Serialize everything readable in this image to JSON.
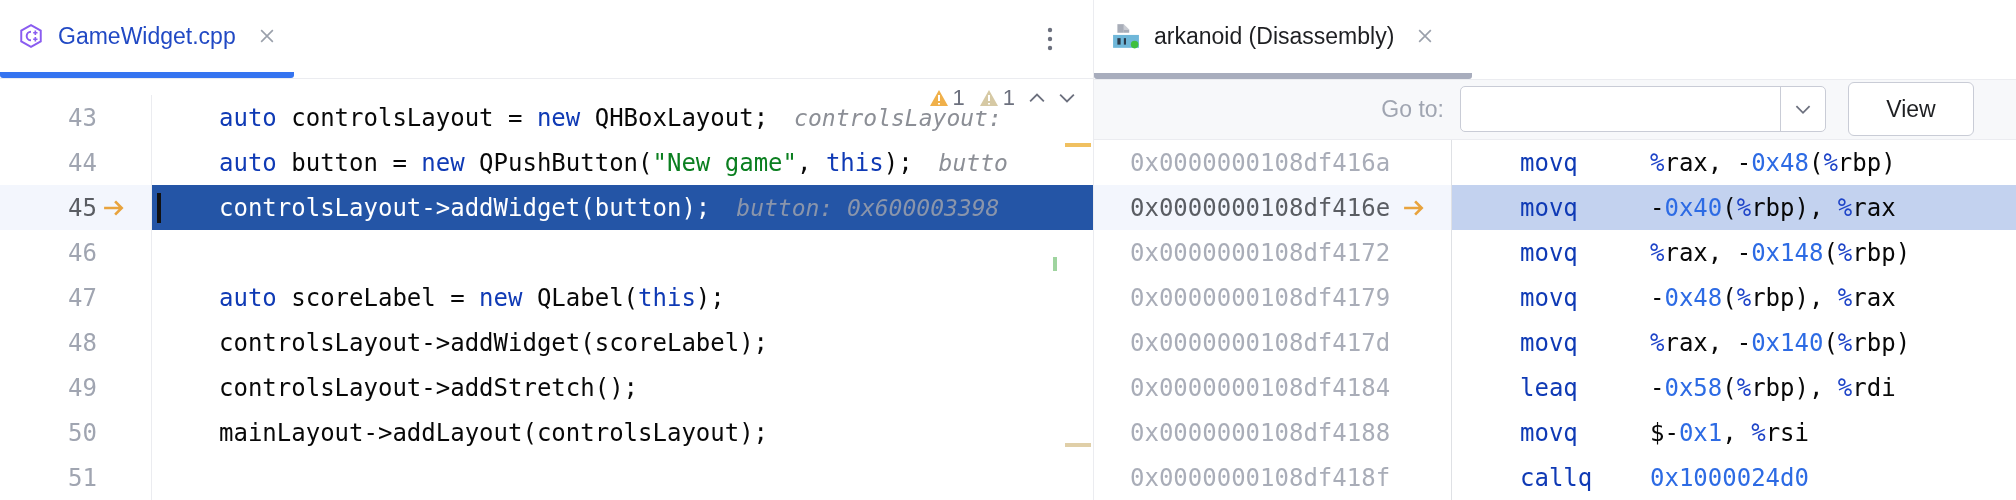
{
  "editor": {
    "focused": true,
    "tab": {
      "label": "GameWidget.cpp",
      "selected": true
    },
    "problems": [
      {
        "kind": "warning",
        "count": "1"
      },
      {
        "kind": "weak",
        "count": "1"
      }
    ],
    "lines": [
      {
        "number": "43",
        "current": false,
        "tokens": [
          {
            "text": "auto",
            "kind": "keyword"
          },
          {
            "text": " controlsLayout = ",
            "kind": "plain"
          },
          {
            "text": "new",
            "kind": "keyword"
          },
          {
            "text": " QHBoxLayout;",
            "kind": "plain"
          }
        ],
        "hint": "controlsLayout:"
      },
      {
        "number": "44",
        "current": false,
        "tokens": [
          {
            "text": "auto",
            "kind": "keyword"
          },
          {
            "text": " button = ",
            "kind": "plain"
          },
          {
            "text": "new",
            "kind": "keyword"
          },
          {
            "text": " QPushButton(",
            "kind": "plain"
          },
          {
            "text": "\"New game\"",
            "kind": "string"
          },
          {
            "text": ", ",
            "kind": "plain"
          },
          {
            "text": "this",
            "kind": "keyword"
          },
          {
            "text": ");",
            "kind": "plain"
          }
        ],
        "hint": "butto"
      },
      {
        "number": "45",
        "current": true,
        "tokens": [
          {
            "text": "controlsLayout->addWidget(button);",
            "kind": "plain"
          }
        ],
        "hint": "button: 0x600003398"
      },
      {
        "number": "46",
        "current": false
      },
      {
        "number": "47",
        "current": false,
        "tokens": [
          {
            "text": "auto",
            "kind": "keyword"
          },
          {
            "text": " scoreLabel = ",
            "kind": "plain"
          },
          {
            "text": "new",
            "kind": "keyword"
          },
          {
            "text": " QLabel(",
            "kind": "plain"
          },
          {
            "text": "this",
            "kind": "keyword"
          },
          {
            "text": ");",
            "kind": "plain"
          }
        ]
      },
      {
        "number": "48",
        "current": false,
        "tokens": [
          {
            "text": "controlsLayout->addWidget(scoreLabel);",
            "kind": "plain"
          }
        ]
      },
      {
        "number": "49",
        "current": false,
        "tokens": [
          {
            "text": "controlsLayout->addStretch();",
            "kind": "plain"
          }
        ]
      },
      {
        "number": "50",
        "current": false,
        "tokens": [
          {
            "text": "mainLayout->addLayout(controlsLayout);",
            "kind": "plain"
          }
        ]
      },
      {
        "number": "51",
        "current": false
      }
    ]
  },
  "disassembly": {
    "focused": false,
    "tab": {
      "label": "arkanoid (Disassembly)",
      "selected": true
    },
    "goto": {
      "label": "Go to:"
    },
    "button": "View",
    "rows": [
      {
        "address": "0x0000000108df416a",
        "current": false,
        "mnemonic": "movq",
        "operands": [
          {
            "text": "%",
            "kind": "reg"
          },
          {
            "text": "rax, -",
            "kind": "plain"
          },
          {
            "text": "0x48",
            "kind": "num"
          },
          {
            "text": "(",
            "kind": "plain"
          },
          {
            "text": "%",
            "kind": "reg"
          },
          {
            "text": "rbp)",
            "kind": "plain"
          }
        ]
      },
      {
        "address": "0x0000000108df416e",
        "current": true,
        "mnemonic": "movq",
        "operands": [
          {
            "text": "-",
            "kind": "plain"
          },
          {
            "text": "0x40",
            "kind": "num"
          },
          {
            "text": "(",
            "kind": "plain"
          },
          {
            "text": "%",
            "kind": "reg"
          },
          {
            "text": "rbp), ",
            "kind": "plain"
          },
          {
            "text": "%",
            "kind": "reg"
          },
          {
            "text": "rax",
            "kind": "plain"
          }
        ]
      },
      {
        "address": "0x0000000108df4172",
        "current": false,
        "mnemonic": "movq",
        "operands": [
          {
            "text": "%",
            "kind": "reg"
          },
          {
            "text": "rax, -",
            "kind": "plain"
          },
          {
            "text": "0x148",
            "kind": "num"
          },
          {
            "text": "(",
            "kind": "plain"
          },
          {
            "text": "%",
            "kind": "reg"
          },
          {
            "text": "rbp)",
            "kind": "plain"
          }
        ]
      },
      {
        "address": "0x0000000108df4179",
        "current": false,
        "mnemonic": "movq",
        "operands": [
          {
            "text": "-",
            "kind": "plain"
          },
          {
            "text": "0x48",
            "kind": "num"
          },
          {
            "text": "(",
            "kind": "plain"
          },
          {
            "text": "%",
            "kind": "reg"
          },
          {
            "text": "rbp), ",
            "kind": "plain"
          },
          {
            "text": "%",
            "kind": "reg"
          },
          {
            "text": "rax",
            "kind": "plain"
          }
        ]
      },
      {
        "address": "0x0000000108df417d",
        "current": false,
        "mnemonic": "movq",
        "operands": [
          {
            "text": "%",
            "kind": "reg"
          },
          {
            "text": "rax, -",
            "kind": "plain"
          },
          {
            "text": "0x140",
            "kind": "num"
          },
          {
            "text": "(",
            "kind": "plain"
          },
          {
            "text": "%",
            "kind": "reg"
          },
          {
            "text": "rbp)",
            "kind": "plain"
          }
        ]
      },
      {
        "address": "0x0000000108df4184",
        "current": false,
        "mnemonic": "leaq",
        "operands": [
          {
            "text": "-",
            "kind": "plain"
          },
          {
            "text": "0x58",
            "kind": "num"
          },
          {
            "text": "(",
            "kind": "plain"
          },
          {
            "text": "%",
            "kind": "reg"
          },
          {
            "text": "rbp), ",
            "kind": "plain"
          },
          {
            "text": "%",
            "kind": "reg"
          },
          {
            "text": "rdi",
            "kind": "plain"
          }
        ]
      },
      {
        "address": "0x0000000108df4188",
        "current": false,
        "mnemonic": "movq",
        "operands": [
          {
            "text": "$-",
            "kind": "plain"
          },
          {
            "text": "0x1",
            "kind": "num"
          },
          {
            "text": ", ",
            "kind": "plain"
          },
          {
            "text": "%",
            "kind": "reg"
          },
          {
            "text": "rsi",
            "kind": "plain"
          }
        ]
      },
      {
        "address": "0x0000000108df418f",
        "current": false,
        "mnemonic": "callq",
        "operands": [
          {
            "text": "0x1000024d0",
            "kind": "num"
          }
        ]
      }
    ]
  }
}
